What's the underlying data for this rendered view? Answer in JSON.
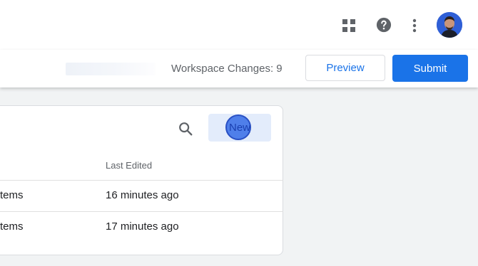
{
  "header": {
    "icons": [
      "apps-grid-icon",
      "help-icon",
      "more-vert-icon"
    ],
    "avatar_icon": "user-avatar"
  },
  "actionbar": {
    "workspace_changes": "Workspace Changes: 9",
    "preview_label": "Preview",
    "submit_label": "Submit"
  },
  "panel": {
    "search_icon": "search-icon",
    "new_label": "New",
    "columns": [
      "Last Edited"
    ],
    "rows": [
      {
        "items": "tems",
        "last_edited": "16 minutes ago"
      },
      {
        "items": "tems",
        "last_edited": "17 minutes ago"
      }
    ]
  },
  "colors": {
    "primary": "#1a73e8",
    "background": "#f1f3f4",
    "new_highlight": "#4f7fea"
  }
}
